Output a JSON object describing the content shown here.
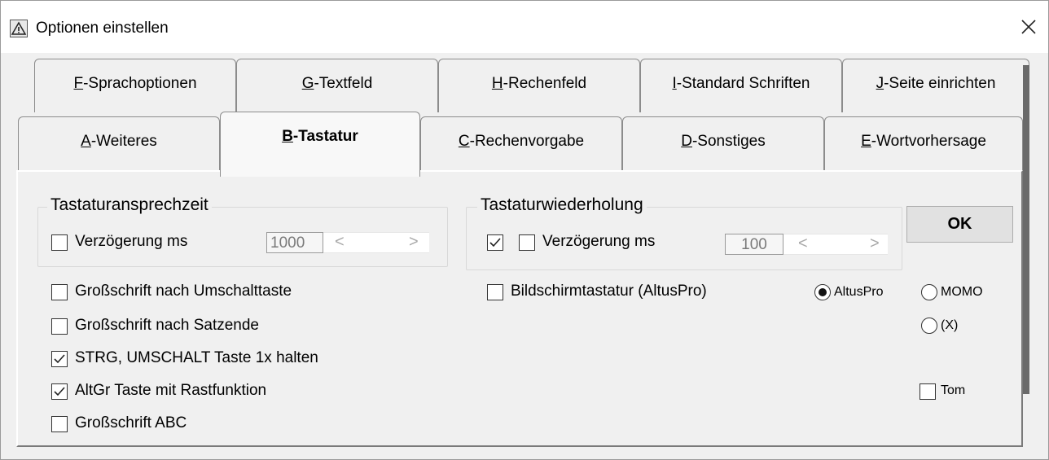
{
  "window": {
    "title": "Optionen einstellen",
    "close_symbol": "✕"
  },
  "tabs_back": [
    {
      "key": "F",
      "rest": "-Sprachoptionen"
    },
    {
      "key": "G",
      "rest": "-Textfeld"
    },
    {
      "key": "H",
      "rest": "-Rechenfeld"
    },
    {
      "key": "I",
      "rest": "-Standard Schriften"
    },
    {
      "key": "J",
      "rest": "-Seite einrichten"
    }
  ],
  "tabs_front": [
    {
      "key": "A",
      "rest": "-Weiteres"
    },
    {
      "key": "B",
      "rest": "-Tastatur"
    },
    {
      "key": "C",
      "rest": "-Rechenvorgabe"
    },
    {
      "key": "D",
      "rest": "-Sonstiges"
    },
    {
      "key": "E",
      "rest": "-Wortvorhersage"
    }
  ],
  "active_tab": "B-Tastatur",
  "group_ansprech": {
    "title": "Tastaturansprechzeit",
    "checkbox_label": "Verzögerung ms",
    "checked": false,
    "value": "1000",
    "left_arrow": "<",
    "right_arrow": ">"
  },
  "group_wiederholung": {
    "title": "Tastaturwiederholung",
    "checkbox_label": "Verzögerung ms",
    "checked_first": true,
    "checked_second": false,
    "value": "100",
    "left_arrow": "<",
    "right_arrow": ">"
  },
  "ok_button": "OK",
  "options": [
    {
      "label": "Großschrift nach Umschalttaste",
      "checked": false
    },
    {
      "label": "Großschrift nach Satzende",
      "checked": false
    },
    {
      "label": "STRG, UMSCHALT Taste 1x halten",
      "checked": true
    },
    {
      "label": "AltGr Taste mit Rastfunktion",
      "checked": true
    },
    {
      "label": "Großschrift ABC",
      "checked": false
    }
  ],
  "screen_keyboard": {
    "label": "Bildschirmtastatur (AltusPro)",
    "checked": false
  },
  "radios": [
    {
      "label": "AltusPro",
      "selected": true
    },
    {
      "label": "MOMO",
      "selected": false
    },
    {
      "label": "(X)",
      "selected": false
    }
  ],
  "tom": {
    "label": "Tom",
    "checked": false
  }
}
